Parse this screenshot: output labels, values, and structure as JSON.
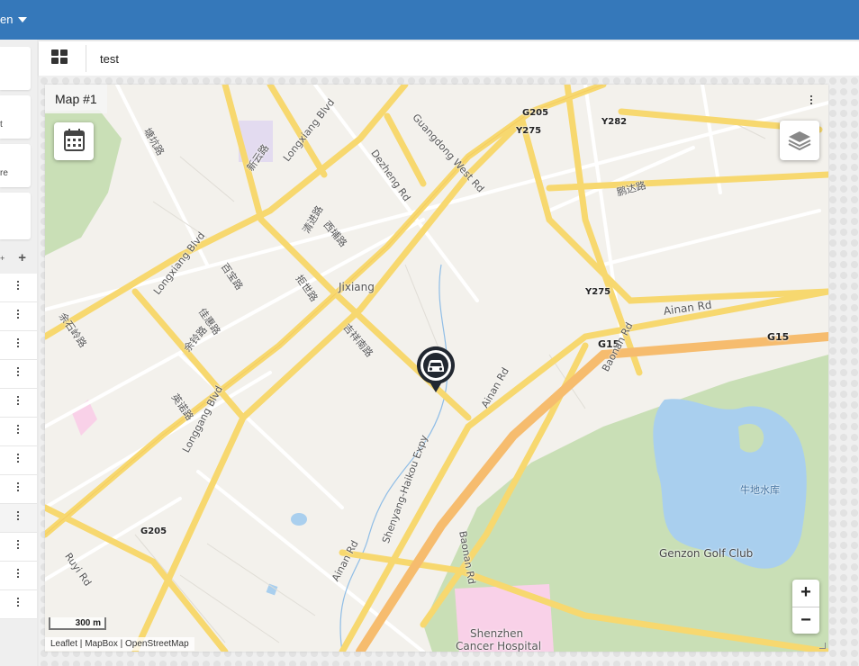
{
  "header": {
    "user_label": "en"
  },
  "sidebar": {
    "cards": [
      {
        "label": ""
      },
      {
        "label": "t"
      },
      {
        "label": "re"
      },
      {
        "label": ""
      }
    ],
    "list_add": "+",
    "list_add_small": "+",
    "row_count": 12
  },
  "toolbar": {
    "title": "test"
  },
  "widget": {
    "title": "Map #1",
    "zoom_in": "+",
    "zoom_out": "−",
    "scale_label": "300 m",
    "attribution": [
      "Leaflet",
      "MapBox",
      "OpenStreetMap"
    ],
    "attribution_sep": " | "
  },
  "map_labels": {
    "jixiang": "Jixiang",
    "aiman_rd": "Ainan Rd",
    "aiman_rd2": "Ainan Rd",
    "aiman_rd3": "Ainan Rd",
    "g15a": "G15",
    "g15b": "G15",
    "g205a": "G205",
    "g205b": "G205",
    "y275a": "Y275",
    "y275b": "Y275",
    "y282": "Y282",
    "longxiang1": "Longxiang Blvd",
    "longxiang2": "Longxiang Blvd",
    "longgang": "Longgang Blvd",
    "dezheng": "Dezheng Rd",
    "baonan1": "Baonan Rd",
    "baonan2": "Baonan Rd",
    "shenyang": "Shenyang-Haikou Expy",
    "ruyi": "Ruyi Rd",
    "guanxi": "Guangdong West Rd",
    "golf": "Genzon Golf Club",
    "hospital1": "Shenzhen",
    "hospital2": "Cancer Hospital",
    "reservoir": "牛地水库",
    "pengda": "鹏达路",
    "xinyun": "新云路",
    "jixiangnan": "吉祥南路",
    "qingjin": "清进路",
    "xipu": "西埔路",
    "yuanshi": "余石岭路",
    "chuangshi": "拒世路",
    "baibao": "百宝路",
    "yuling": "余铃路",
    "jiahua": "佳惠路",
    "yingnuo": "英诺路",
    "tangkeng": "塘坑路"
  },
  "colors": {
    "header": "#3578ba",
    "road_major": "#f7d86f",
    "road_expy": "#f6bc6e",
    "water": "#a9cfee",
    "park": "#c9dfb6",
    "land": "#f3f1ec",
    "hospital": "#f9d1e8",
    "marker": "#222831"
  },
  "icons": {
    "calendar": "calendar-icon",
    "layers": "layers-icon",
    "marker": "car-marker-icon",
    "dashboards": "grid-icon"
  }
}
